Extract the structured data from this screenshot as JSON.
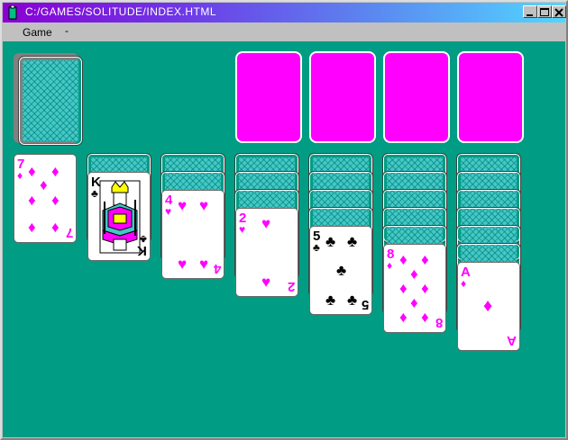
{
  "window": {
    "title": "C:/GAMES/SOLITUDE/INDEX.HTML"
  },
  "menu": {
    "items": [
      "Game"
    ],
    "more": "-"
  },
  "colors": {
    "felt": "#009c84",
    "foundation": "#ff00ff",
    "red_suit": "#ff00ff",
    "card_back": "#41c9c5"
  },
  "stock": {
    "state": "face-down"
  },
  "foundations": [
    {
      "state": "empty"
    },
    {
      "state": "empty"
    },
    {
      "state": "empty"
    },
    {
      "state": "empty"
    }
  ],
  "tableau": [
    {
      "hidden": 0,
      "top": {
        "rank": "7",
        "suit": "diamonds",
        "symbol": "♦"
      }
    },
    {
      "hidden": 1,
      "top": {
        "rank": "K",
        "suit": "clubs",
        "symbol": "♣"
      }
    },
    {
      "hidden": 2,
      "top": {
        "rank": "4",
        "suit": "hearts",
        "symbol": "♥"
      }
    },
    {
      "hidden": 3,
      "top": {
        "rank": "2",
        "suit": "hearts",
        "symbol": "♥"
      }
    },
    {
      "hidden": 4,
      "top": {
        "rank": "5",
        "suit": "clubs",
        "symbol": "♣"
      }
    },
    {
      "hidden": 5,
      "top": {
        "rank": "8",
        "suit": "diamonds",
        "symbol": "♦"
      }
    },
    {
      "hidden": 6,
      "top": {
        "rank": "A",
        "suit": "diamonds",
        "symbol": "♦"
      }
    }
  ]
}
